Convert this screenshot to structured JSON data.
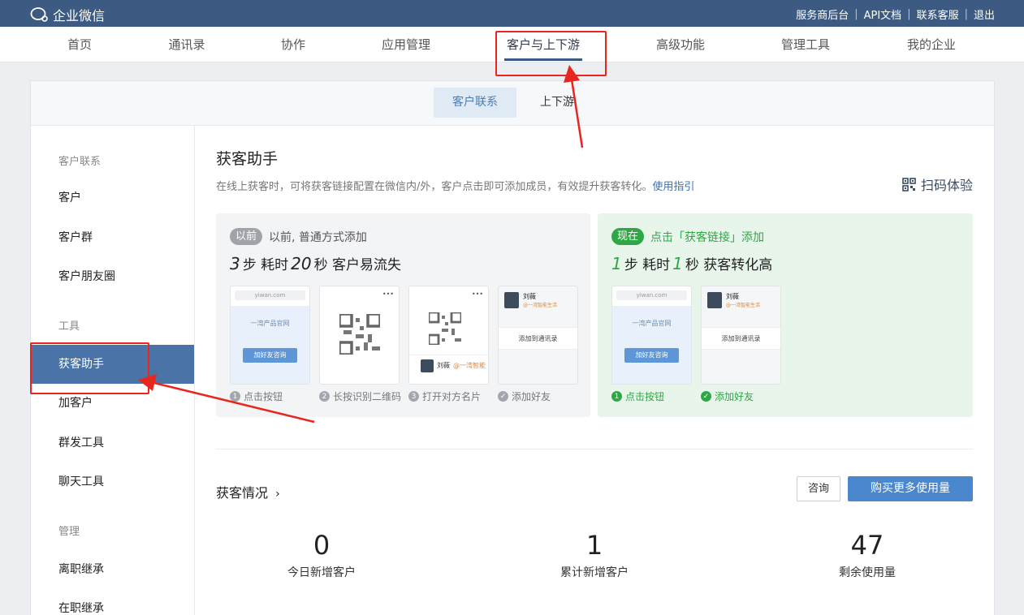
{
  "topbar": {
    "logo_text": "企业微信",
    "links": [
      "服务商后台",
      "API文档",
      "联系客服",
      "退出"
    ]
  },
  "nav": {
    "items": [
      "首页",
      "通讯录",
      "协作",
      "应用管理",
      "客户与上下游",
      "高级功能",
      "管理工具",
      "我的企业"
    ],
    "active": "客户与上下游"
  },
  "subtabs": [
    "客户联系",
    "上下游"
  ],
  "sidebar": {
    "group1": "客户联系",
    "items1": [
      "客户",
      "客户群",
      "客户朋友圈"
    ],
    "group2": "工具",
    "items2": [
      "获客助手",
      "加客户",
      "群发工具",
      "聊天工具"
    ],
    "group3": "管理",
    "items3": [
      "离职继承",
      "在职继承"
    ],
    "active": "获客助手"
  },
  "main": {
    "title": "获客助手",
    "desc": "在线上获客时，可将获客链接配置在微信内/外，客户点击即可添加成员，有效提升获客转化。",
    "guide_link": "使用指引",
    "scan_label": "扫码体验",
    "before": {
      "badge": "以前",
      "headline": "以前, 普通方式添加",
      "n1": "3",
      "w1": "步 耗时",
      "n2": "20",
      "w2": "秒 客户易流失",
      "steps": [
        "点击按钮",
        "长按识别二维码",
        "打开对方名片",
        "添加好友"
      ]
    },
    "now": {
      "badge": "现在",
      "headline": "点击「获客链接」添加",
      "n1": "1",
      "w1": "步 耗时",
      "n2": "1",
      "w2": "秒 获客转化高",
      "steps": [
        "点击按钮",
        "添加好友"
      ]
    },
    "mock": {
      "url": "yiwan.com",
      "site_title": "一湾产品官网",
      "consult_btn": "加好友咨询",
      "more": "•••",
      "contact_name": "刘薇",
      "contact_org": "@一湾智能生活",
      "contact_org_short": "@一湾智能",
      "add_contact": "添加到通讯录"
    },
    "stats_title": "获客情况",
    "consult_btn": "咨询",
    "buy_btn": "购买更多使用量",
    "stats": [
      {
        "value": "0",
        "label": "今日新增客户"
      },
      {
        "value": "1",
        "label": "累计新增客户"
      },
      {
        "value": "47",
        "label": "剩余使用量"
      }
    ]
  },
  "colors": {
    "topbar": "#3d5b82",
    "accent": "#4a87cc",
    "sidebar_active": "#4a74a8",
    "green": "#2fa745",
    "annotation_red": "#e8261f"
  },
  "icons": [
    "chat-logo-icon",
    "qr-scan-icon",
    "chevron-right-icon",
    "check-icon",
    "qr-code-icon"
  ]
}
